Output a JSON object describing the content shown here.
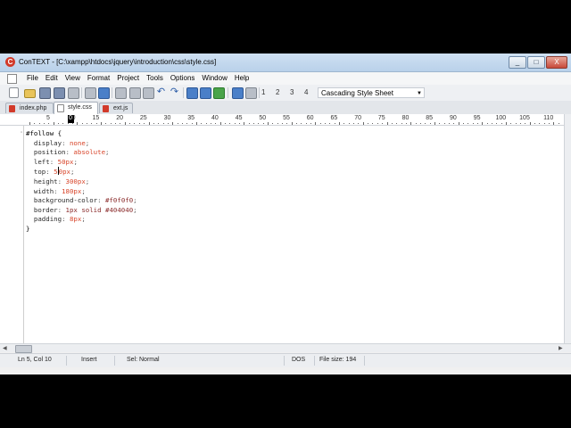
{
  "window": {
    "title": "ConTEXT - [C:\\xampp\\htdocs\\jquery\\introduction\\css\\style.css]",
    "app_icon_letter": "C",
    "minimize": "_",
    "maximize": "□",
    "close": "X"
  },
  "menu": [
    "File",
    "Edit",
    "View",
    "Format",
    "Project",
    "Tools",
    "Options",
    "Window",
    "Help"
  ],
  "toolbar": {
    "bookmark_labels": [
      "1",
      "2",
      "3",
      "4"
    ],
    "syntax": "Cascading Style Sheet"
  },
  "tabs": [
    {
      "label": "index.php",
      "active": false
    },
    {
      "label": "style.css",
      "active": true
    },
    {
      "label": "ext.js",
      "active": false
    }
  ],
  "ruler": {
    "cursor": "0",
    "ticks": [
      "5",
      "10",
      "15",
      "20",
      "25",
      "30",
      "35",
      "40",
      "45",
      "50",
      "55",
      "60",
      "65",
      "70",
      "75",
      "80",
      "85",
      "90",
      "95",
      "100",
      "105",
      "110"
    ]
  },
  "code": {
    "selector": "#follow {",
    "lines": [
      {
        "prop": "display",
        "val": "none"
      },
      {
        "prop": "position",
        "val": "absolute"
      },
      {
        "prop": "left",
        "val": "50px"
      },
      {
        "prop": "top",
        "val": "50px"
      },
      {
        "prop": "height",
        "val": "300px"
      },
      {
        "prop": "width",
        "val": "180px"
      },
      {
        "prop": "background-color",
        "val": "#f0f0f0"
      },
      {
        "prop": "border",
        "val": "1px solid #404040"
      },
      {
        "prop": "padding",
        "val": "8px"
      }
    ],
    "close": "}"
  },
  "status": {
    "position": "Ln 5, Col 10",
    "mode": "Insert",
    "selection": "Sel: Normal",
    "line_endings": "DOS",
    "file_size": "File size: 194"
  }
}
